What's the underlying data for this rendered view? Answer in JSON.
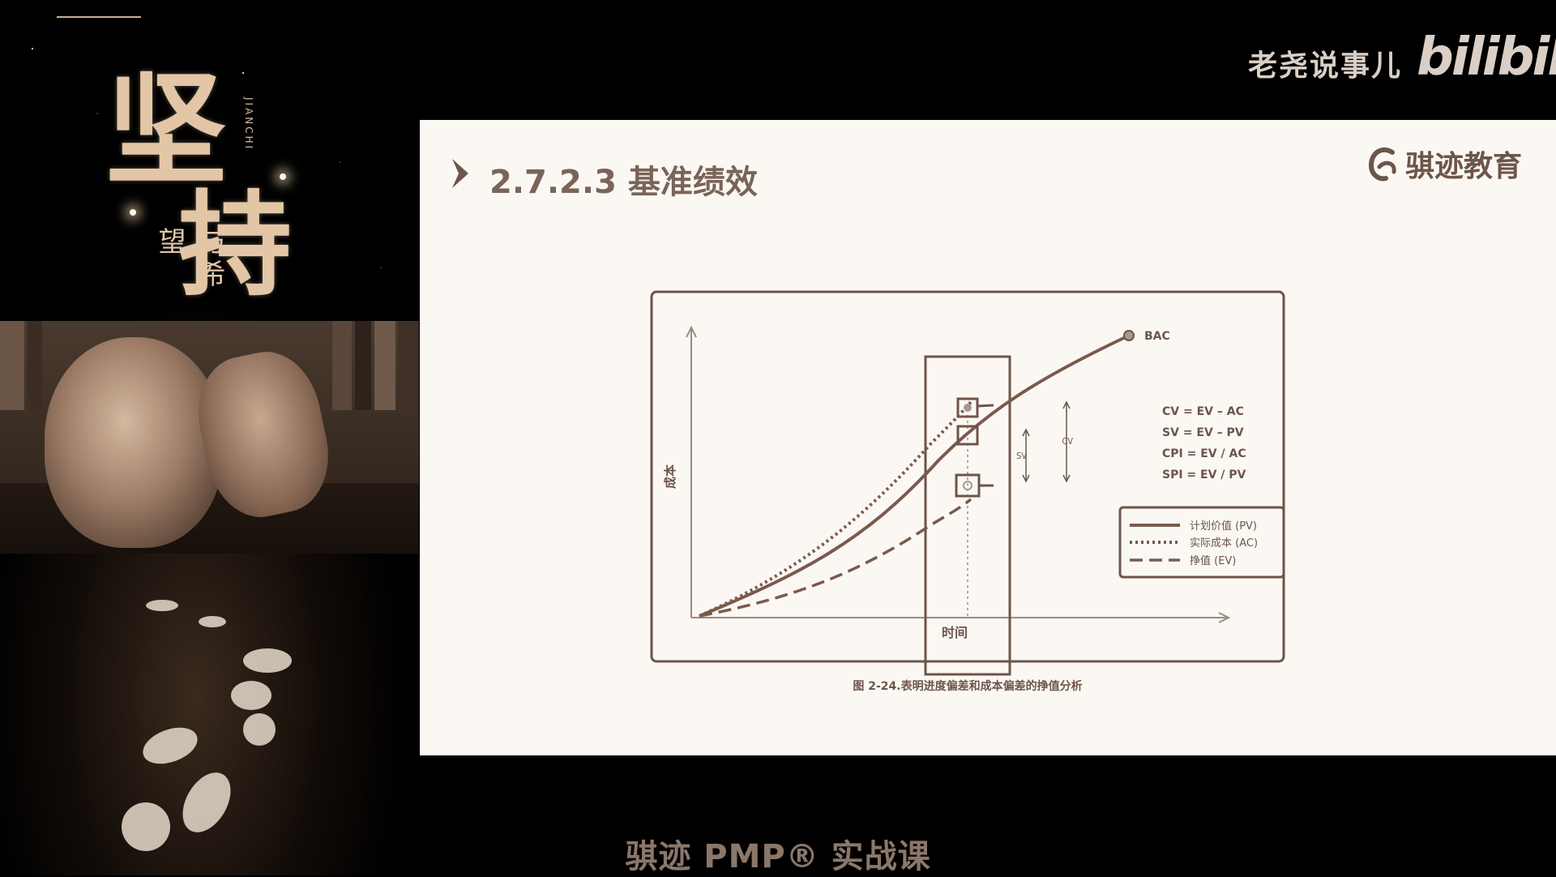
{
  "channel": {
    "name": "老尧说事儿",
    "platform": "bilibili"
  },
  "poster": {
    "char1": "坚",
    "char2": "持",
    "subtitle": "与希望",
    "pinyin": "JIANCHI"
  },
  "slide": {
    "title": "2.7.2.3 基准绩效",
    "brand": "骐迹教育"
  },
  "chart_data": {
    "type": "line",
    "ylabel": "成本",
    "xlabel": "时间",
    "caption": "图 2-24.表明进度偏差和成本偏差的挣值分析",
    "endpoint_label": "BAC",
    "variance_labels": {
      "sv": "SV",
      "cv": "CV"
    },
    "formulas": [
      "CV = EV – AC",
      "SV = EV – PV",
      "CPI = EV / AC",
      "SPI = EV / PV"
    ],
    "legend": [
      {
        "label": "计划价值 (PV)",
        "style": "solid"
      },
      {
        "label": "实际成本 (AC)",
        "style": "dotted"
      },
      {
        "label": "挣值 (EV)",
        "style": "dashed"
      }
    ],
    "colors": {
      "line": "#7a5a4c",
      "frame": "#6d5549"
    }
  },
  "footer": {
    "caption": "骐迹 PMP® 实战课"
  }
}
